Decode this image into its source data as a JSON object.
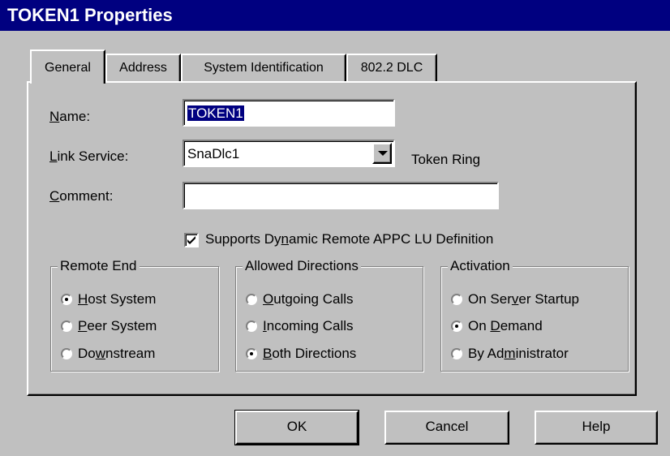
{
  "window": {
    "title": "TOKEN1 Properties"
  },
  "tabs": [
    {
      "label": "General",
      "active": true
    },
    {
      "label": "Address",
      "active": false
    },
    {
      "label": "System Identification",
      "active": false
    },
    {
      "label": "802.2 DLC",
      "active": false
    }
  ],
  "general": {
    "name_label_hotkey": "N",
    "name_label_rest": "ame:",
    "name_value": "TOKEN1",
    "link_service_label_hotkey": "L",
    "link_service_label_rest": "ink Service:",
    "link_service_value": "SnaDlc1",
    "link_service_type": "Token Ring",
    "comment_label_hotkey": "C",
    "comment_label_rest": "omment:",
    "comment_value": "",
    "dynamic_checkbox": {
      "pre": "Supports Dy",
      "hotkey": "n",
      "post": "amic Remote APPC LU Definition",
      "checked": true
    }
  },
  "remote_end": {
    "legend": "Remote End",
    "options": [
      {
        "pre": "",
        "hotkey": "H",
        "post": "ost System",
        "selected": true
      },
      {
        "pre": "",
        "hotkey": "P",
        "post": "eer System",
        "selected": false
      },
      {
        "pre": "Do",
        "hotkey": "w",
        "post": "nstream",
        "selected": false
      }
    ]
  },
  "allowed_directions": {
    "legend": "Allowed Directions",
    "options": [
      {
        "pre": "",
        "hotkey": "O",
        "post": "utgoing Calls",
        "selected": false
      },
      {
        "pre": "",
        "hotkey": "I",
        "post": "ncoming Calls",
        "selected": false
      },
      {
        "pre": "",
        "hotkey": "B",
        "post": "oth Directions",
        "selected": true
      }
    ]
  },
  "activation": {
    "legend": "Activation",
    "options": [
      {
        "pre": "On Ser",
        "hotkey": "v",
        "post": "er Startup",
        "selected": false
      },
      {
        "pre": "On ",
        "hotkey": "D",
        "post": "emand",
        "selected": true
      },
      {
        "pre": "By Ad",
        "hotkey": "m",
        "post": "inistrator",
        "selected": false
      }
    ]
  },
  "buttons": {
    "ok": "OK",
    "cancel": "Cancel",
    "help": "Help"
  }
}
